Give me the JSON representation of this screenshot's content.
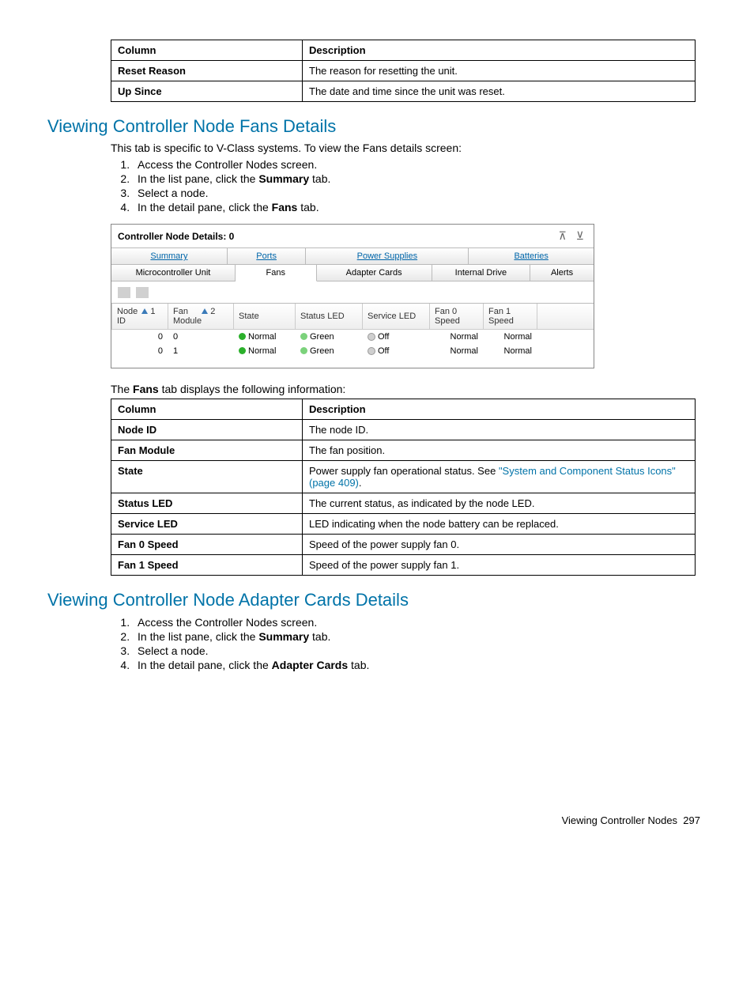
{
  "table1": {
    "head": [
      "Column",
      "Description"
    ],
    "rows": [
      [
        "Reset Reason",
        "The reason for resetting the unit."
      ],
      [
        "Up Since",
        "The date and time since the unit was reset."
      ]
    ]
  },
  "section1": {
    "heading": "Viewing Controller Node Fans Details",
    "intro": "This tab is specific to V-Class systems. To view the Fans details screen:",
    "steps": [
      {
        "pre": "Access the Controller Nodes screen.",
        "bold": "",
        "post": ""
      },
      {
        "pre": "In the list pane, click the ",
        "bold": "Summary",
        "post": " tab."
      },
      {
        "pre": "Select a node.",
        "bold": "",
        "post": ""
      },
      {
        "pre": "In the detail pane, click the ",
        "bold": "Fans",
        "post": " tab."
      }
    ]
  },
  "screenshot": {
    "title": "Controller Node Details: 0",
    "tabs_row1": [
      "Summary",
      "Ports",
      "Power Supplies",
      "Batteries"
    ],
    "tabs_row2": [
      "Microcontroller Unit",
      "Fans",
      "Adapter Cards",
      "Internal Drive",
      "Alerts"
    ],
    "selected_tab": "Fans",
    "grid": {
      "headers": [
        "Node ID",
        "Fan Module",
        "State",
        "Status LED",
        "Service LED",
        "Fan 0 Speed",
        "Fan 1 Speed"
      ],
      "header_display": [
        {
          "t": "Node",
          "sort": "1"
        },
        {
          "t": "Fan Module",
          "sort": "2"
        },
        {
          "t": "State"
        },
        {
          "t": "Status LED"
        },
        {
          "t": "Service LED"
        },
        {
          "t": "Fan 0 Speed"
        },
        {
          "t": "Fan 1 Speed"
        }
      ],
      "rows": [
        {
          "node": "0",
          "fan": "0",
          "state": "Normal",
          "status": "Green",
          "service": "Off",
          "f0": "Normal",
          "f1": "Normal"
        },
        {
          "node": "0",
          "fan": "1",
          "state": "Normal",
          "status": "Green",
          "service": "Off",
          "f0": "Normal",
          "f1": "Normal"
        }
      ]
    }
  },
  "after_ss": "The Fans tab displays the following information:",
  "after_ss_bold": "Fans",
  "table2": {
    "head": [
      "Column",
      "Description"
    ],
    "rows": [
      {
        "c": "Node ID",
        "d": "The node ID."
      },
      {
        "c": "Fan Module",
        "d": "The fan position."
      },
      {
        "c": "State",
        "d_pre": "Power supply fan operational status. See ",
        "d_link": "\"System and Component Status Icons\" (page 409)",
        "d_post": "."
      },
      {
        "c": "Status LED",
        "d": "The current status, as indicated by the node LED."
      },
      {
        "c": "Service LED",
        "d": "LED indicating when the node battery can be replaced."
      },
      {
        "c": "Fan 0 Speed",
        "d": "Speed of the power supply fan 0."
      },
      {
        "c": "Fan 1 Speed",
        "d": "Speed of the power supply fan 1."
      }
    ]
  },
  "section2": {
    "heading": "Viewing Controller Node Adapter Cards Details",
    "steps": [
      {
        "pre": "Access the Controller Nodes screen.",
        "bold": "",
        "post": ""
      },
      {
        "pre": "In the list pane, click the ",
        "bold": "Summary",
        "post": " tab."
      },
      {
        "pre": "Select a node.",
        "bold": "",
        "post": ""
      },
      {
        "pre": "In the detail pane, click the ",
        "bold": "Adapter Cards",
        "post": " tab."
      }
    ]
  },
  "footer": {
    "text": "Viewing Controller Nodes",
    "page": "297"
  }
}
